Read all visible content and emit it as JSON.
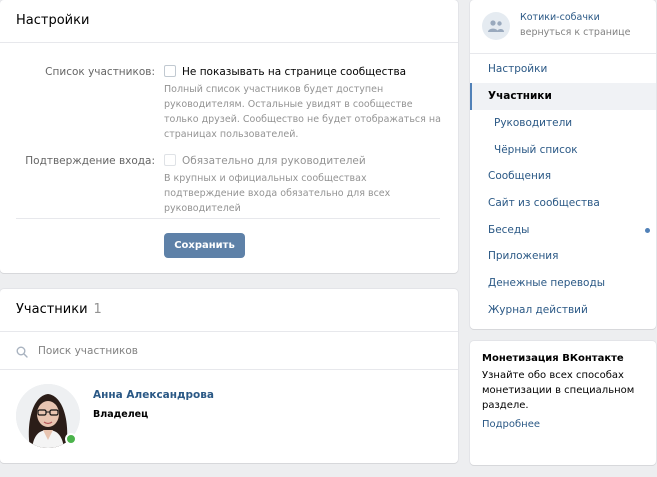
{
  "settings": {
    "title": "Настройки",
    "members_list": {
      "label": "Список участников:",
      "checkbox_label": "Не показывать на странице сообщества",
      "hint": "Полный список участников будет доступен руководителям. Остальные увидят в сообществе только друзей. Сообщество не будет отображаться на страницах пользователей."
    },
    "login_confirm": {
      "label": "Подтверждение входа:",
      "checkbox_label": "Обязательно для руководителей",
      "hint": "В крупных и официальных сообществах подтверждение входа обязательно для всех руководителей"
    },
    "save_label": "Сохранить"
  },
  "members": {
    "title": "Участники",
    "count": "1",
    "search_placeholder": "Поиск участников",
    "list": [
      {
        "name": "Анна Александрова",
        "role": "Владелец",
        "online": true
      }
    ]
  },
  "group": {
    "name": "Котики-собачки",
    "back_link": "вернуться к странице"
  },
  "nav": {
    "items": [
      {
        "label": "Настройки"
      },
      {
        "label": "Участники",
        "active": true
      },
      {
        "label": "Руководители"
      },
      {
        "label": "Чёрный список"
      },
      {
        "label": "Сообщения"
      },
      {
        "label": "Сайт из сообщества"
      },
      {
        "label": "Беседы",
        "has_dot": true
      },
      {
        "label": "Приложения"
      },
      {
        "label": "Денежные переводы"
      },
      {
        "label": "Журнал действий"
      }
    ]
  },
  "promo": {
    "title": "Монетизация ВКонтакте",
    "text": "Узнайте обо всех способах монетизации в специальном разделе.",
    "link": "Подробнее"
  },
  "colors": {
    "accent": "#5181b8",
    "button": "#5e81a8",
    "link": "#2a5885",
    "online": "#4bb34b",
    "background": "#edeef0"
  }
}
